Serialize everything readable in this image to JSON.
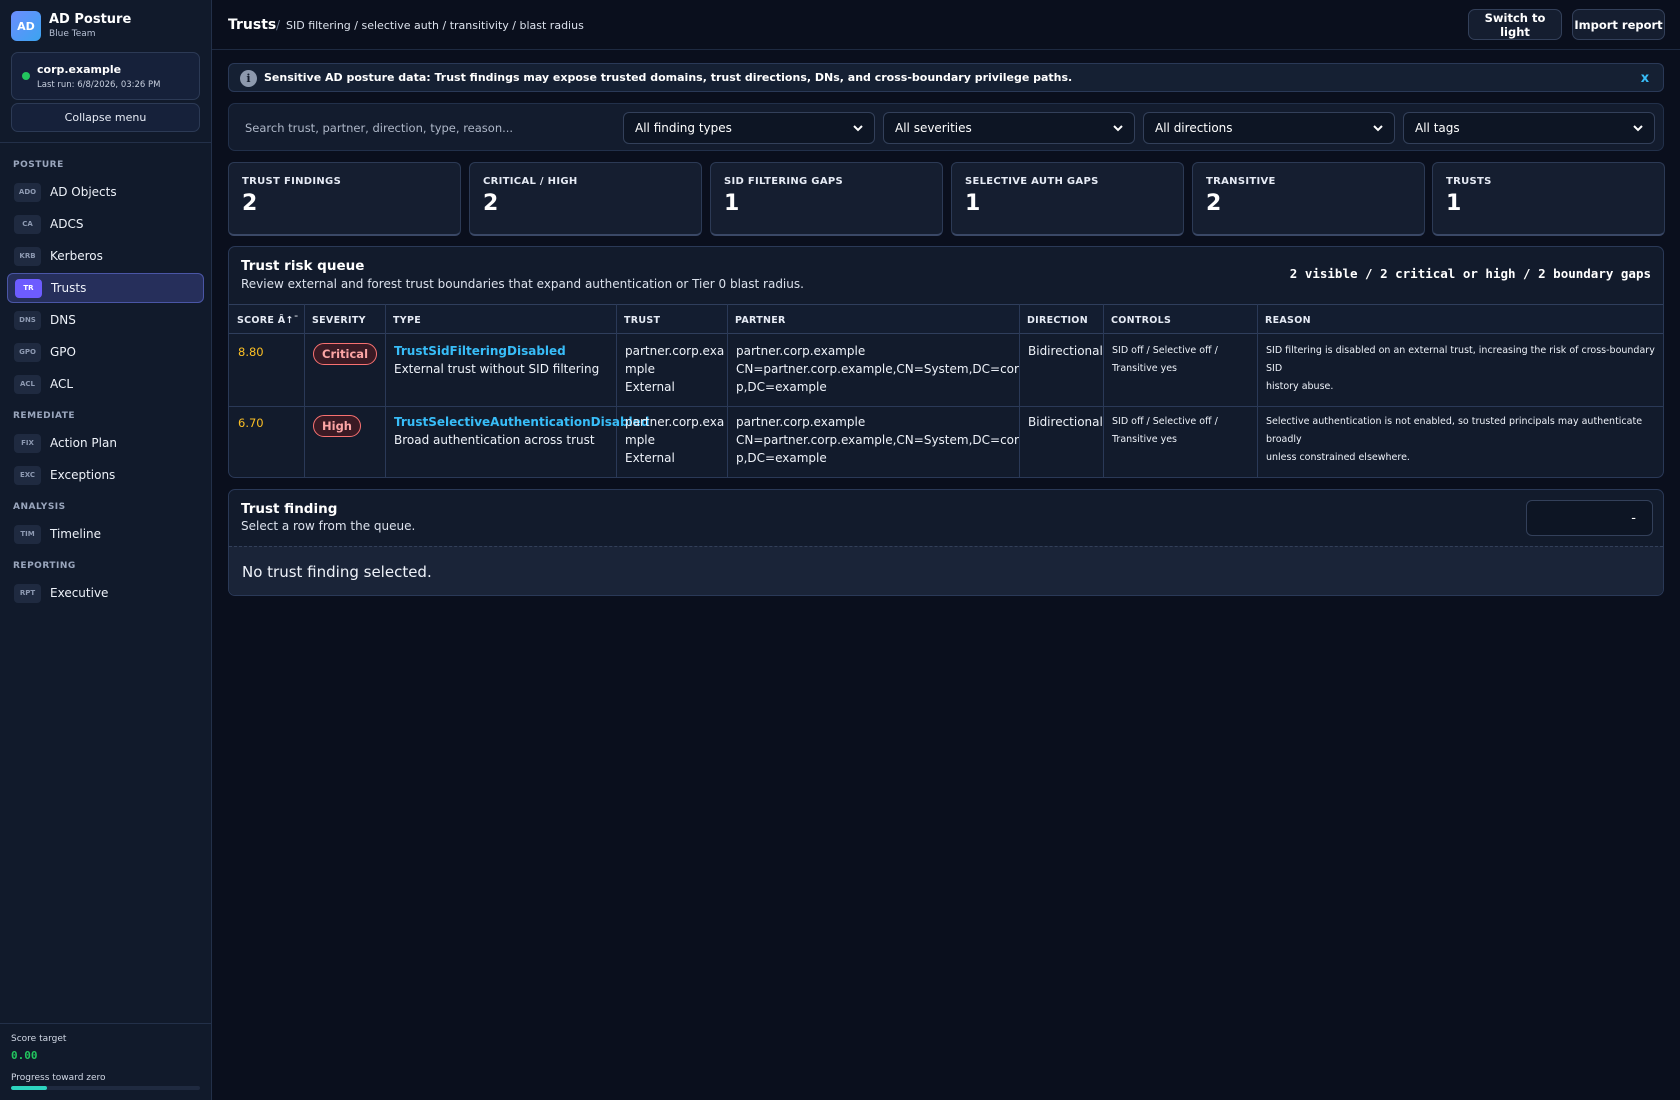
{
  "app": {
    "logo": "AD",
    "title": "AD Posture",
    "subtitle": "Blue Team"
  },
  "environment": {
    "domain": "corp.example",
    "last_run": "Last run: 6/8/2026, 03:26 PM",
    "status_color": "#22c55e"
  },
  "sidebar": {
    "collapse_label": "Collapse menu",
    "sections": [
      {
        "label": "POSTURE",
        "items": [
          {
            "badge": "ADO",
            "label": "AD Objects",
            "active": false
          },
          {
            "badge": "CA",
            "label": "ADCS",
            "active": false
          },
          {
            "badge": "KRB",
            "label": "Kerberos",
            "active": false
          },
          {
            "badge": "TR",
            "label": "Trusts",
            "active": true
          },
          {
            "badge": "DNS",
            "label": "DNS",
            "active": false
          },
          {
            "badge": "GPO",
            "label": "GPO",
            "active": false
          },
          {
            "badge": "ACL",
            "label": "ACL",
            "active": false
          }
        ]
      },
      {
        "label": "REMEDIATE",
        "items": [
          {
            "badge": "FIX",
            "label": "Action Plan",
            "active": false
          },
          {
            "badge": "EXC",
            "label": "Exceptions",
            "active": false
          }
        ]
      },
      {
        "label": "ANALYSIS",
        "items": [
          {
            "badge": "TIM",
            "label": "Timeline",
            "active": false
          }
        ]
      },
      {
        "label": "REPORTING",
        "items": [
          {
            "badge": "RPT",
            "label": "Executive",
            "active": false
          }
        ]
      }
    ],
    "footer": {
      "score_label": "Score target",
      "score_value": "0.00",
      "progress_label": "Progress toward zero",
      "progress_fraction": 0.19,
      "progress_color": "#2dd4bf"
    }
  },
  "topbar": {
    "title": "Trusts",
    "separator": "/",
    "breadcrumb": "SID filtering / selective auth / transitivity / blast radius",
    "switch_label": "Switch to light",
    "import_label": "Import report"
  },
  "alert": {
    "icon": "i",
    "text": "Sensitive AD posture data: Trust findings may expose trusted domains, trust directions, DNs, and cross-boundary privilege paths.",
    "close": "x"
  },
  "filters": {
    "search_placeholder": "Search trust, partner, direction, type, reason...",
    "selects": [
      "All finding types",
      "All severities",
      "All directions",
      "All tags"
    ]
  },
  "stats": [
    {
      "label": "TRUST FINDINGS",
      "value": "2"
    },
    {
      "label": "CRITICAL / HIGH",
      "value": "2"
    },
    {
      "label": "SID FILTERING GAPS",
      "value": "1"
    },
    {
      "label": "SELECTIVE AUTH GAPS",
      "value": "1"
    },
    {
      "label": "TRANSITIVE",
      "value": "2"
    },
    {
      "label": "TRUSTS",
      "value": "1"
    }
  ],
  "queue": {
    "title": "Trust risk queue",
    "subtitle": "Review external and forest trust boundaries that expand authentication or Tier 0 blast radius.",
    "summary": "2 visible / 2 critical or high / 2 boundary gaps",
    "columns": [
      "SCORE Â↑¯",
      "SEVERITY",
      "TYPE",
      "TRUST",
      "PARTNER",
      "DIRECTION",
      "CONTROLS",
      "REASON"
    ],
    "rows": [
      {
        "score": "8.80",
        "severity": "Critical",
        "severity_level": "critical",
        "type": "TrustSidFilteringDisabled",
        "type_desc": "External trust without SID filtering",
        "trust_l1": "partner.corp.exa",
        "trust_l2": "mple",
        "trust_kind": "External",
        "partner": "partner.corp.example",
        "partner_dn_l1": "CN=partner.corp.example,CN=System,DC=cor",
        "partner_dn_l2": "p,DC=example",
        "direction": "Bidirectional",
        "controls_l1": "SID off / Selective off /",
        "controls_l2": "Transitive yes",
        "reason_l1": "SID filtering is disabled on an external trust, increasing the risk of cross-boundary SID",
        "reason_l2": "history abuse."
      },
      {
        "score": "6.70",
        "severity": "High",
        "severity_level": "high",
        "type": "TrustSelectiveAuthenticationDisabled",
        "type_desc": "Broad authentication across trust",
        "trust_l1": "partner.corp.exa",
        "trust_l2": "mple",
        "trust_kind": "External",
        "partner": "partner.corp.example",
        "partner_dn_l1": "CN=partner.corp.example,CN=System,DC=cor",
        "partner_dn_l2": "p,DC=example",
        "direction": "Bidirectional",
        "controls_l1": "SID off / Selective off /",
        "controls_l2": "Transitive yes",
        "reason_l1": "Selective authentication is not enabled, so trusted principals may authenticate broadly",
        "reason_l2": "unless constrained elsewhere."
      }
    ]
  },
  "detail": {
    "title": "Trust finding",
    "subtitle": "Select a row from the queue.",
    "select_value": "-",
    "empty": "No trust finding selected."
  },
  "colors": {
    "accent": "#6d5cff",
    "link": "#38bdf8",
    "score": "#fbbf24",
    "critical": "#f87171"
  }
}
